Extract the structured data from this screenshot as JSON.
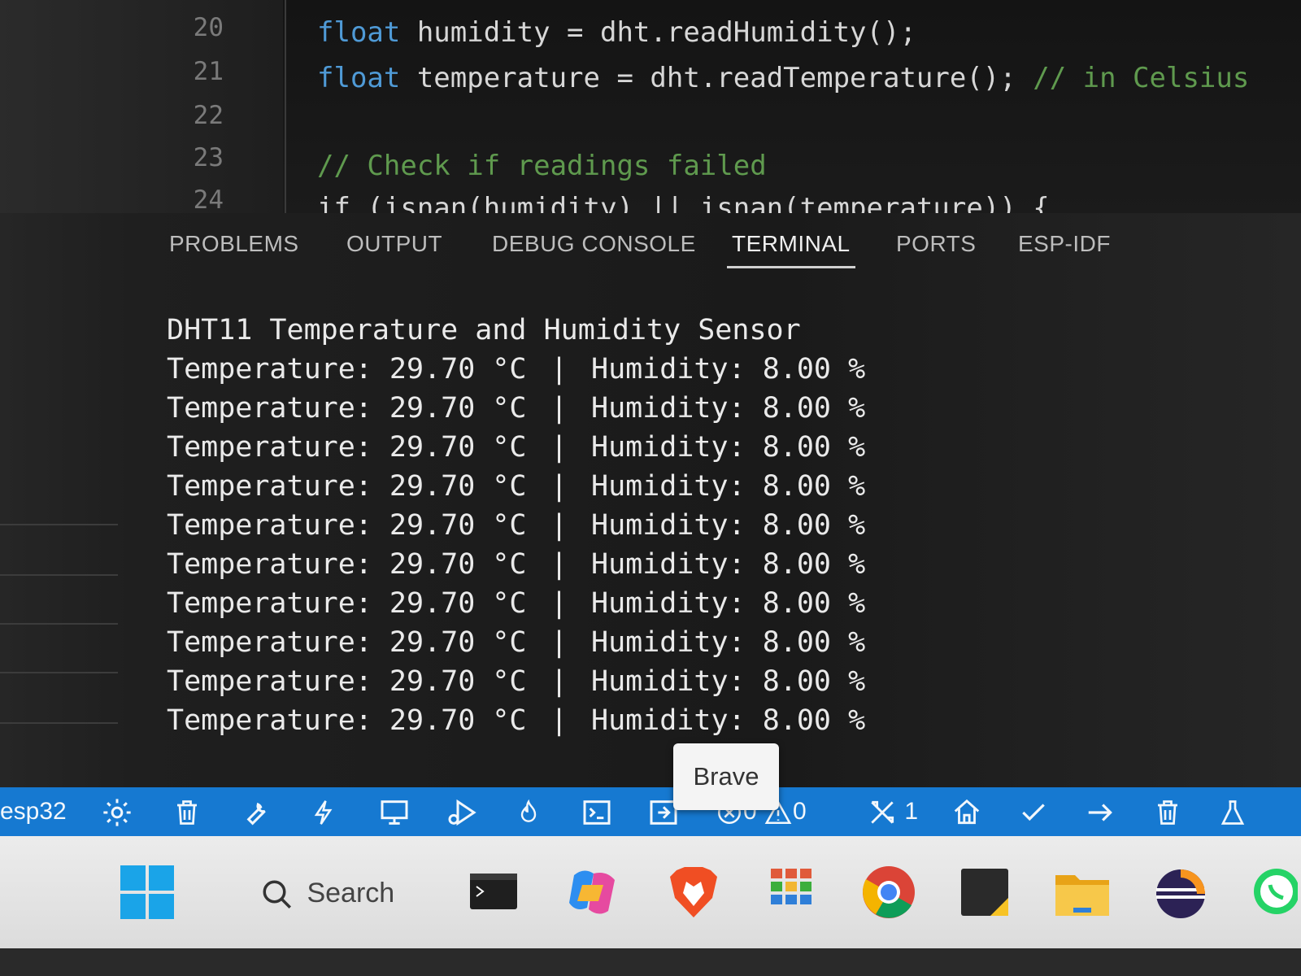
{
  "editor": {
    "lines": [
      {
        "num": "20",
        "keyword": "float",
        "code": " humidity = dht.readHumidity();",
        "comment": ""
      },
      {
        "num": "21",
        "keyword": "float",
        "code": " temperature = dht.readTemperature(); ",
        "comment": "// in Celsius"
      },
      {
        "num": "22",
        "keyword": "",
        "code": "",
        "comment": ""
      },
      {
        "num": "23",
        "keyword": "",
        "code": "",
        "comment": "// Check if readings failed"
      },
      {
        "num": "24",
        "keyword": "",
        "code": "if (isnan(humidity) || isnan(temperature)) {",
        "comment": ""
      }
    ]
  },
  "panel": {
    "tabs": [
      "PROBLEMS",
      "OUTPUT",
      "DEBUG CONSOLE",
      "TERMINAL",
      "PORTS",
      "ESP-IDF"
    ],
    "active_tab": "TERMINAL"
  },
  "terminal": {
    "title": "DHT11 Temperature and Humidity Sensor",
    "rows": [
      {
        "temp": "Temperature: 29.70 °C",
        "sep": "|",
        "hum": "Humidity: 8.00 %"
      },
      {
        "temp": "Temperature: 29.70 °C",
        "sep": "|",
        "hum": "Humidity: 8.00 %"
      },
      {
        "temp": "Temperature: 29.70 °C",
        "sep": "|",
        "hum": "Humidity: 8.00 %"
      },
      {
        "temp": "Temperature: 29.70 °C",
        "sep": "|",
        "hum": "Humidity: 8.00 %"
      },
      {
        "temp": "Temperature: 29.70 °C",
        "sep": "|",
        "hum": "Humidity: 8.00 %"
      },
      {
        "temp": "Temperature: 29.70 °C",
        "sep": "|",
        "hum": "Humidity: 8.00 %"
      },
      {
        "temp": "Temperature: 29.70 °C",
        "sep": "|",
        "hum": "Humidity: 8.00 %"
      },
      {
        "temp": "Temperature: 29.70 °C",
        "sep": "|",
        "hum": "Humidity: 8.00 %"
      },
      {
        "temp": "Temperature: 29.70 °C",
        "sep": "|",
        "hum": "Humidity: 8.00 %"
      },
      {
        "temp": "Temperature: 29.70 °C",
        "sep": "|",
        "hum": "Humidity: 8.00 %"
      }
    ]
  },
  "statusbar": {
    "target": "esp32",
    "errors": "0",
    "warnings": "0",
    "tools_count": "1",
    "icons": [
      "gear-icon",
      "trash-icon",
      "wrench-icon",
      "flash-icon",
      "monitor-icon",
      "debug-icon",
      "flame-icon",
      "terminal-icon",
      "run-icon",
      "error-icon",
      "warning-icon",
      "tools-icon",
      "home-icon",
      "check-icon",
      "arrow-right-icon",
      "trash-icon",
      "flask-icon"
    ],
    "background": "#1679d1"
  },
  "tooltip": {
    "text": "Brave"
  },
  "taskbar": {
    "search_label": "Search",
    "apps": [
      "windows-start-icon",
      "terminal-app-icon",
      "copilot-icon",
      "brave-icon",
      "calculator-icon",
      "chrome-icon",
      "sticky-notes-icon",
      "file-explorer-icon",
      "eclipse-icon",
      "whatsapp-icon"
    ]
  }
}
